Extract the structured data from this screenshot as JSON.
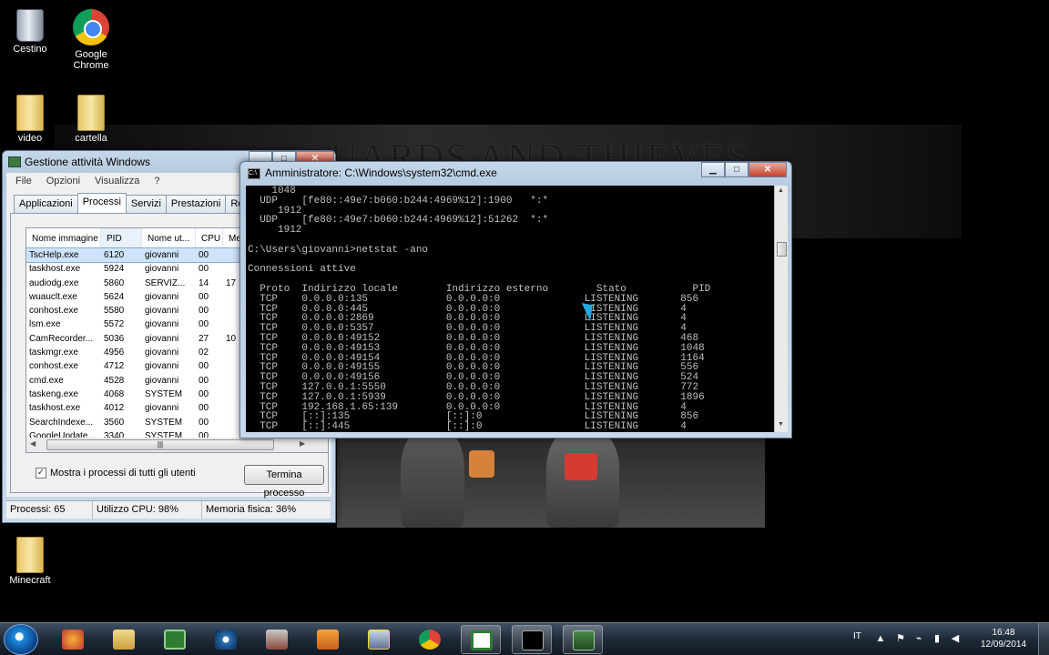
{
  "desktop": {
    "banner_text": "GUARDS AND THIEVES",
    "icons": [
      {
        "label": "Cestino",
        "icon": "recycle-bin-icon"
      },
      {
        "label": "Google Chrome",
        "icon": "chrome-icon"
      },
      {
        "label": "video",
        "icon": "folder-icon"
      },
      {
        "label": "cartella",
        "icon": "folder-icon"
      },
      {
        "label": "Minecraft",
        "icon": "folder-icon"
      }
    ]
  },
  "taskmgr": {
    "title": "Gestione attività Windows",
    "menu": [
      "File",
      "Opzioni",
      "Visualizza",
      "?"
    ],
    "tabs": [
      "Applicazioni",
      "Processi",
      "Servizi",
      "Prestazioni",
      "Rete",
      "U"
    ],
    "active_tab": "Processi",
    "columns": [
      "Nome immagine",
      "PID",
      "Nome ut...",
      "CPU",
      "Me"
    ],
    "rows": [
      {
        "name": "TscHelp.exe",
        "pid": "6120",
        "user": "giovanni",
        "cpu": "00",
        "mem": ""
      },
      {
        "name": "taskhost.exe",
        "pid": "5924",
        "user": "giovanni",
        "cpu": "00",
        "mem": ""
      },
      {
        "name": "audiodg.exe",
        "pid": "5860",
        "user": "SERVIZ...",
        "cpu": "14",
        "mem": "17"
      },
      {
        "name": "wuauclt.exe",
        "pid": "5624",
        "user": "giovanni",
        "cpu": "00",
        "mem": ""
      },
      {
        "name": "conhost.exe",
        "pid": "5580",
        "user": "giovanni",
        "cpu": "00",
        "mem": ""
      },
      {
        "name": "lsm.exe",
        "pid": "5572",
        "user": "giovanni",
        "cpu": "00",
        "mem": ""
      },
      {
        "name": "CamRecorder...",
        "pid": "5036",
        "user": "giovanni",
        "cpu": "27",
        "mem": "10"
      },
      {
        "name": "taskmgr.exe",
        "pid": "4956",
        "user": "giovanni",
        "cpu": "02",
        "mem": ""
      },
      {
        "name": "conhost.exe",
        "pid": "4712",
        "user": "giovanni",
        "cpu": "00",
        "mem": ""
      },
      {
        "name": "cmd.exe",
        "pid": "4528",
        "user": "giovanni",
        "cpu": "00",
        "mem": ""
      },
      {
        "name": "taskeng.exe",
        "pid": "4068",
        "user": "SYSTEM",
        "cpu": "00",
        "mem": ""
      },
      {
        "name": "taskhost.exe",
        "pid": "4012",
        "user": "giovanni",
        "cpu": "00",
        "mem": ""
      },
      {
        "name": "SearchIndexe...",
        "pid": "3560",
        "user": "SYSTEM",
        "cpu": "00",
        "mem": ""
      },
      {
        "name": "GoogleUpdate...",
        "pid": "3340",
        "user": "SYSTEM",
        "cpu": "00",
        "mem": ""
      }
    ],
    "show_all_label": "Mostra i processi di tutti gli utenti",
    "show_all_checked": true,
    "end_process_label": "Termina processo",
    "status": {
      "processes": "Processi: 65",
      "cpu": "Utilizzo CPU: 98%",
      "memory": "Memoria fisica: 36%"
    }
  },
  "cmd": {
    "title": "Amministratore: C:\\Windows\\system32\\cmd.exe",
    "output": "    1048\n  UDP    [fe80::49e7:b060:b244:4969%12]:1900   *:*\n     1912\n  UDP    [fe80::49e7:b060:b244:4969%12]:51262  *:*\n     1912\n\nC:\\Users\\giovanni>netstat -ano\n\nConnessioni attive\n\n  Proto  Indirizzo locale        Indirizzo esterno        Stato           PID\n  TCP    0.0.0.0:135             0.0.0.0:0              LISTENING       856\n  TCP    0.0.0.0:445             0.0.0.0:0              LISTENING       4\n  TCP    0.0.0.0:2869            0.0.0.0:0              LISTENING       4\n  TCP    0.0.0.0:5357            0.0.0.0:0              LISTENING       4\n  TCP    0.0.0.0:49152           0.0.0.0:0              LISTENING       468\n  TCP    0.0.0.0:49153           0.0.0.0:0              LISTENING       1048\n  TCP    0.0.0.0:49154           0.0.0.0:0              LISTENING       1164\n  TCP    0.0.0.0:49155           0.0.0.0:0              LISTENING       556\n  TCP    0.0.0.0:49156           0.0.0.0:0              LISTENING       524\n  TCP    127.0.0.1:5550          0.0.0.0:0              LISTENING       772\n  TCP    127.0.0.1:5939          0.0.0.0:0              LISTENING       1896\n  TCP    192.168.1.65:139        0.0.0.0:0              LISTENING       4\n  TCP    [::]:135                [::]:0                 LISTENING       856\n  TCP    [::]:445                [::]:0                 LISTENING       4"
  },
  "taskbar": {
    "language": "IT",
    "time": "16:48",
    "date": "12/09/2014",
    "apps": [
      {
        "icon": "start-orb-icon"
      },
      {
        "icon": "mozilla-icon"
      },
      {
        "icon": "explorer-folder-icon"
      },
      {
        "icon": "minecraft-launcher-icon"
      },
      {
        "icon": "media-icon"
      },
      {
        "icon": "toolbox-icon"
      },
      {
        "icon": "media-player-icon"
      },
      {
        "icon": "recorder-icon"
      },
      {
        "icon": "chrome-icon"
      },
      {
        "icon": "minecraft-icon"
      },
      {
        "icon": "cmd-icon"
      },
      {
        "icon": "taskmgr-icon"
      }
    ]
  }
}
